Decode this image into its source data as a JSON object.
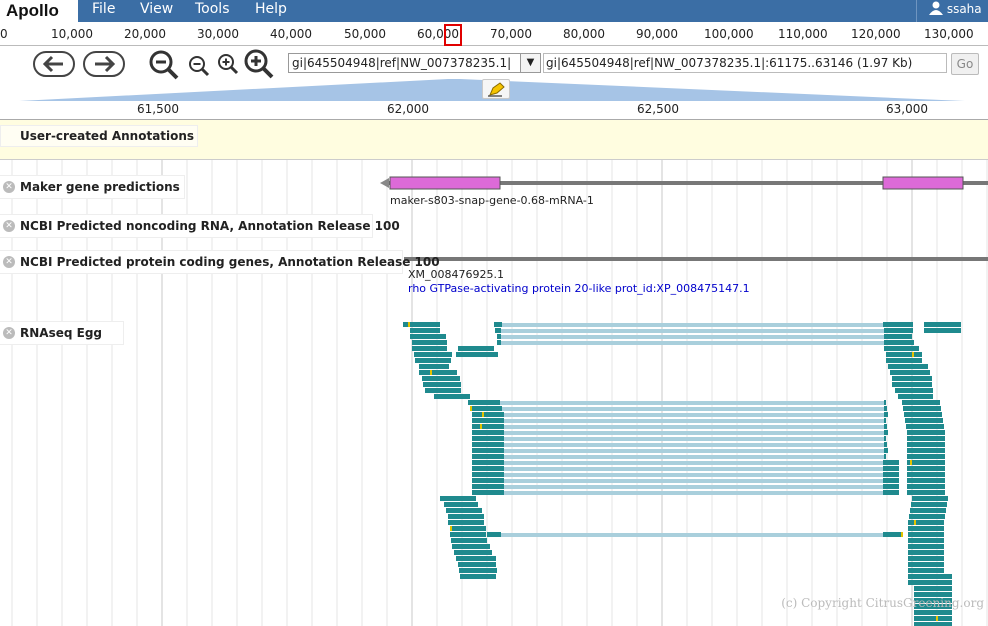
{
  "app": {
    "logo": "Apollo",
    "user": "ssaha"
  },
  "menu": [
    "File",
    "View",
    "Tools",
    "Help"
  ],
  "overview": {
    "ticks": [
      "0",
      "10,000",
      "20,000",
      "30,000",
      "40,000",
      "50,000",
      "60,000",
      "70,000",
      "80,000",
      "90,000",
      "100,000",
      "110,000",
      "120,000",
      "130,000"
    ]
  },
  "nav": {
    "refseq": "gi|645504948|ref|NW_007378235.1|",
    "location": "gi|645504948|ref|NW_007378235.1|:61175..63146 (1.97 Kb)",
    "go_label": "Go"
  },
  "detail_ruler": {
    "ticks": [
      "61,500",
      "62,000",
      "62,500",
      "63,000"
    ]
  },
  "user_annotations": {
    "label": "User-created Annotations"
  },
  "tracks": [
    {
      "label": "Maker gene predictions"
    },
    {
      "label": "NCBI Predicted noncoding RNA, Annotation Release 100"
    },
    {
      "label": "NCBI Predicted protein coding genes, Annotation Release 100"
    },
    {
      "label": "RNAseq Egg"
    }
  ],
  "features": {
    "maker_name": "maker-s803-snap-gene-0.68-mRNA-1",
    "ncbi_name": "XM_008476925.1",
    "ncbi_desc": "rho GTPase-activating protein 20-like prot_id:XP_008475147.1"
  },
  "colors": {
    "menubar": "#3b6ea5",
    "maker_exon": "#dd6ad8",
    "rnaseq_exon": "#1f8a8e",
    "rnaseq_intron": "#a9cfdc",
    "ncbi_desc": "#0000cc"
  },
  "copyright": "(c) Copyright CitrusGreening.org"
}
